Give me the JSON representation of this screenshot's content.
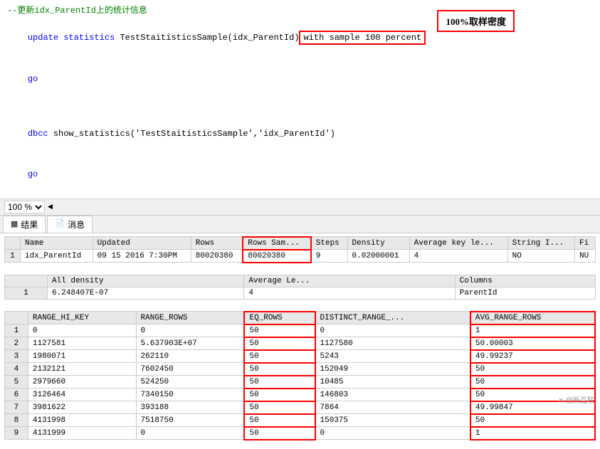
{
  "code": {
    "comment": "--更新idx_ParentId上的统计信息",
    "line1_pre": "update statistics TestStaitisticsSample(idx_ParentId)",
    "line1_highlight": "with sample 100 percent",
    "line2": "go",
    "line3": "",
    "line4_pre": "dbcc show_statistics('TestStaitisticsSample','idx_ParentId')",
    "line5": "go",
    "callout": "100%取样密度"
  },
  "toolbar": {
    "zoom": "100 %",
    "arrow": "◄"
  },
  "tabs": [
    {
      "label": "结果",
      "icon": "▦"
    },
    {
      "label": "消息",
      "icon": "📄"
    }
  ],
  "table1": {
    "headers": [
      "",
      "Name",
      "Updated",
      "Rows",
      "Rows Sam...",
      "Steps",
      "Density",
      "Average key le...",
      "String I...",
      "Fi"
    ],
    "rows": [
      [
        "1",
        "idx_ParentId",
        "09 15 2016  7:30PM",
        "80020380",
        "80020380",
        "9",
        "0.02000001",
        "4",
        "NO",
        "NU"
      ]
    ],
    "highlight_col": 4
  },
  "table2": {
    "headers": [
      "",
      "All density",
      "Average Le...",
      "Columns"
    ],
    "rows": [
      [
        "1",
        "6.248407E-07",
        "4",
        "ParentId"
      ]
    ]
  },
  "table3": {
    "headers": [
      "",
      "RANGE_HI_KEY",
      "RANGE_ROWS",
      "EQ_ROWS",
      "DISTINCT_RANGE_...",
      "AVG_RANGE_ROWS"
    ],
    "rows": [
      [
        "1",
        "0",
        "0",
        "50",
        "0",
        "1"
      ],
      [
        "2",
        "1127581",
        "5.637903E+07",
        "50",
        "1127580",
        "50.00003"
      ],
      [
        "3",
        "1980071",
        "262110",
        "50",
        "5243",
        "49.99237"
      ],
      [
        "4",
        "2132121",
        "7602450",
        "50",
        "152049",
        "50"
      ],
      [
        "5",
        "2979660",
        "524250",
        "50",
        "10485",
        "50"
      ],
      [
        "6",
        "3126464",
        "7340150",
        "50",
        "146803",
        "50"
      ],
      [
        "7",
        "3981622",
        "393188",
        "50",
        "7864",
        "49.99847"
      ],
      [
        "8",
        "4131998",
        "7518750",
        "50",
        "150375",
        "50"
      ],
      [
        "9",
        "4131999",
        "0",
        "50",
        "0",
        "1"
      ]
    ],
    "highlight_cols": [
      3,
      5
    ]
  },
  "watermark": "创新互联"
}
